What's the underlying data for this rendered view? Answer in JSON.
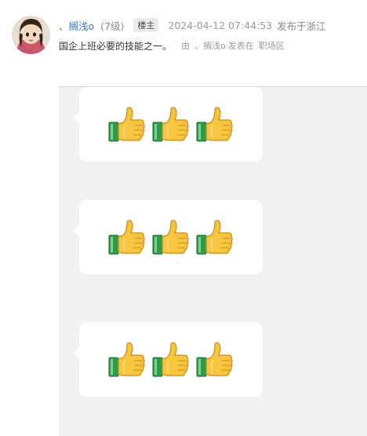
{
  "post": {
    "username": "、搁浅o",
    "level": "(7级)",
    "owner_badge": "楼主",
    "timestamp": "2024-04-12 07:44:53",
    "location": "发布于浙江",
    "text": "国企上班必要的技能之一。",
    "via_prefix": "由",
    "via_user": "、搁浅o",
    "via_action": "发表在",
    "board": "职场区"
  },
  "image": {
    "bubbles": [
      {
        "icons": [
          "thumbs-up-icon",
          "thumbs-up-icon",
          "thumbs-up-icon"
        ]
      },
      {
        "icons": [
          "thumbs-up-icon",
          "thumbs-up-icon",
          "thumbs-up-icon"
        ]
      },
      {
        "icons": [
          "thumbs-up-icon",
          "thumbs-up-icon",
          "thumbs-up-icon"
        ]
      }
    ]
  },
  "colors": {
    "username": "#3a7cc1",
    "chat_background": "#f1f1f1",
    "bubble": "#ffffff",
    "thumb_yellow": "#f6c640",
    "cuff_green": "#2e9a4a"
  }
}
